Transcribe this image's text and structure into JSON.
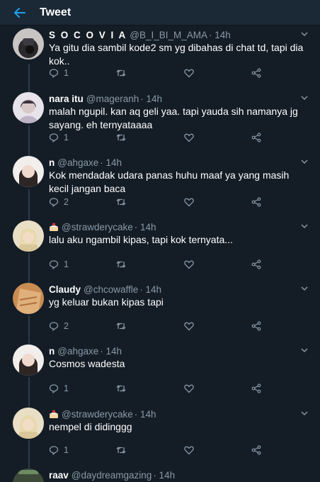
{
  "header": {
    "title": "Tweet"
  },
  "colors": {
    "background": "#141d26",
    "header": "#1b2836",
    "accent": "#1da1f2",
    "muted": "#8899a6"
  },
  "tweets": [
    {
      "name": "S O C O V I A",
      "handle": "@B_I_BI_M_AMA",
      "time": "· 14h",
      "text": "Ya gitu dia sambil kode2 sm yg dibahas di chat td, tapi dia kok..",
      "replies": "1"
    },
    {
      "name": "nara itu",
      "handle": "@mageranh",
      "time": "· 14h",
      "text": "malah ngupil. kan aq geli yaa. tapi yauda sih namanya jg sayang. eh ternyataaaa",
      "replies": "1"
    },
    {
      "name": "n",
      "handle": "@ahgaxe",
      "time": "· 14h",
      "text": "Kok mendadak udara panas huhu maaf ya yang masih kecil jangan baca",
      "replies": "2"
    },
    {
      "name": "",
      "name_icon": "cake-icon",
      "handle": "@strawderycake",
      "time": "· 14h",
      "text": "lalu aku ngambil kipas, tapi kok ternyata...",
      "replies": "1"
    },
    {
      "name": "Claudy",
      "handle": "@chcowaffle",
      "time": "· 14h",
      "text": "yg keluar bukan kipas tapi",
      "replies": "2"
    },
    {
      "name": "n",
      "handle": "@ahgaxe",
      "time": "· 14h",
      "text": "Cosmos wadesta",
      "replies": "1"
    },
    {
      "name": "",
      "name_icon": "cake-icon",
      "handle": "@strawderycake",
      "time": "· 14h",
      "text": "nempel di didinggg",
      "replies": "1"
    },
    {
      "name": "raav",
      "handle": "@daydreamgazing",
      "time": "· 14h"
    }
  ]
}
